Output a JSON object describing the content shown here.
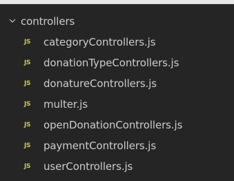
{
  "explorer": {
    "folder": {
      "name": "controllers",
      "expanded": true,
      "chevron_icon": "chevron-down-icon"
    },
    "file_icon_text": "JS",
    "file_icon_color": "#cbcb41",
    "files": [
      {
        "name": "categoryControllers.js"
      },
      {
        "name": "donationTypeControllers.js"
      },
      {
        "name": "donatureControllers.js"
      },
      {
        "name": "multer.js"
      },
      {
        "name": "openDonationControllers.js"
      },
      {
        "name": "paymentControllers.js"
      },
      {
        "name": "userControllers.js"
      }
    ]
  }
}
